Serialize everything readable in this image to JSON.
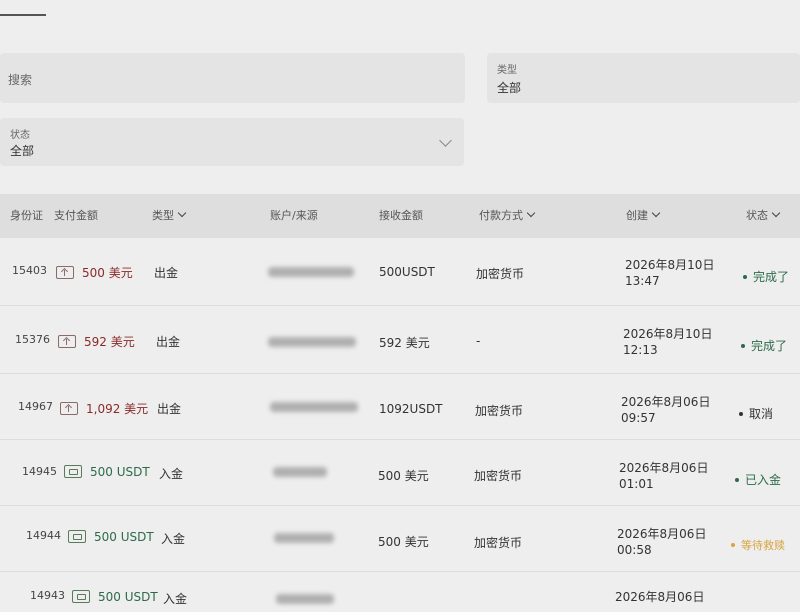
{
  "filters": {
    "search_placeholder": "搜索",
    "type_label": "类型",
    "type_value": "全部",
    "status_label": "状态",
    "status_value": "全部"
  },
  "table": {
    "headers": {
      "id": "身份证",
      "pay_amount": "支付金额",
      "type": "类型",
      "account": "账户/来源",
      "received": "接收金额",
      "method": "付款方式",
      "created": "创建",
      "status": "状态"
    },
    "rows": [
      {
        "id": "15403",
        "pay": "500 美元",
        "type": "出金",
        "received": "500USDT",
        "method": "加密货币",
        "date": "2026年8月10日",
        "time": "13:47",
        "status": "完成了"
      },
      {
        "id": "15376",
        "pay": "592 美元",
        "type": "出金",
        "received": "592 美元",
        "method": "-",
        "date": "2026年8月10日",
        "time": "12:13",
        "status": "完成了"
      },
      {
        "id": "14967",
        "pay": "1,092 美元",
        "type": "出金",
        "received": "1092USDT",
        "method": "加密货币",
        "date": "2026年8月06日",
        "time": "09:57",
        "status": "取消"
      },
      {
        "id": "14945",
        "pay": "500 USDT",
        "type": "入金",
        "received": "500 美元",
        "method": "加密货币",
        "date": "2026年8月06日",
        "time": "01:01",
        "status": "已入金"
      },
      {
        "id": "14944",
        "pay": "500 USDT",
        "type": "入金",
        "received": "500 美元",
        "method": "加密货币",
        "date": "2026年8月06日",
        "time": "00:58",
        "status": "等待救赎"
      },
      {
        "id": "14943",
        "pay": "500 USDT",
        "type": "入金",
        "received": "",
        "method": "",
        "date": "2026年8月06日",
        "time": "",
        "status": ""
      }
    ]
  },
  "colors": {
    "out_amount": "#8b2a2a",
    "in_amount": "#2c6b4a",
    "status_done": "#2c6b4a",
    "status_cancel": "#333333",
    "status_pending": "#d9a441"
  }
}
